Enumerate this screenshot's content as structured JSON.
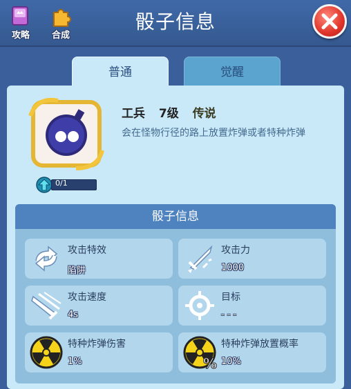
{
  "header": {
    "guide_label": "攻略",
    "combine_label": "合成",
    "title": "骰子信息"
  },
  "tabs": [
    {
      "label": "普通",
      "active": true
    },
    {
      "label": "觉醒",
      "active": false
    }
  ],
  "dice": {
    "name": "工兵",
    "level": "7级",
    "rarity": "传说",
    "description": "会在怪物行径的路上放置炸弹或者特种炸弹",
    "progress_text": "0/1",
    "progress": 0
  },
  "stats": {
    "section_title": "骰子信息",
    "items": [
      {
        "label": "攻击特效",
        "value": "陷阱",
        "icon": "swap-arrows-icon"
      },
      {
        "label": "攻击力",
        "value": "1000",
        "icon": "attack-sword-icon"
      },
      {
        "label": "攻击速度",
        "value": "4s",
        "icon": "speed-slash-icon"
      },
      {
        "label": "目标",
        "value": "---",
        "icon": "crosshair-icon"
      },
      {
        "label": "特种炸弹伤害",
        "value": "1%",
        "icon": "radiation-icon"
      },
      {
        "label": "特种炸弹放置概率",
        "value": "10%",
        "icon": "radiation-percent-icon"
      }
    ]
  },
  "colors": {
    "header_bg": "#3f69a8",
    "panel_bg": "#c9e9f8",
    "stats_header_bg": "#4e83bf",
    "close_red": "#e0342a",
    "rarity_gold": "#f2c53d",
    "radiation_yellow": "#f4d31a"
  }
}
